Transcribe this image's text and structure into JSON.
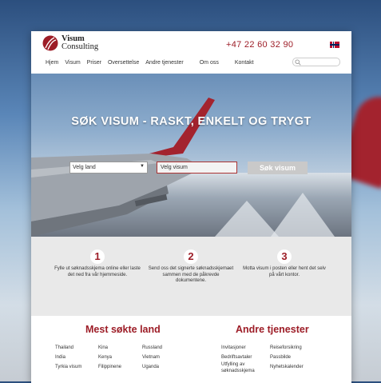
{
  "logo": {
    "line1": "Visum",
    "line2": "Consulting"
  },
  "header": {
    "phone": "+47 22 60 32 90"
  },
  "nav": [
    "Hjem",
    "Visum",
    "Priser",
    "Oversettelse",
    "Andre tjenester",
    "Om oss",
    "Kontakt"
  ],
  "hero": {
    "title": "SØK VISUM - RASKT, ENKELT OG TRYGT",
    "country_select": "Velg land",
    "visa_select": "Velg visum",
    "search_button": "Søk visum"
  },
  "steps": [
    {
      "num": "1",
      "text": "Fylle ut søknadsskjema online eller laste det ned fra vår hjemmeside."
    },
    {
      "num": "2",
      "text": "Send oss det signerte søknadsskjemaet sammen med de påkrevde dokumentene."
    },
    {
      "num": "3",
      "text": "Motta visum i posten eller hent det selv på vårt kontor."
    }
  ],
  "popular": {
    "title": "Mest søkte land",
    "col1": [
      "Thailand",
      "India",
      "Tyrkia visum"
    ],
    "col2": [
      "Kina",
      "Kenya",
      "Filippinene"
    ],
    "col3": [
      "Russland",
      "Vietnam",
      "Uganda"
    ]
  },
  "services": {
    "title": "Andre tjenester",
    "col1": [
      "Invitasjoner",
      "Bedriftsavtaler",
      "Utfylling av søknadsskjema"
    ],
    "col2": [
      "Reiseforsikring",
      "Passbilde",
      "Nyhetskalender"
    ]
  },
  "colors": {
    "accent": "#9d1d27",
    "steps_bg": "#e9e9e9",
    "button": "#c9c9c9"
  }
}
